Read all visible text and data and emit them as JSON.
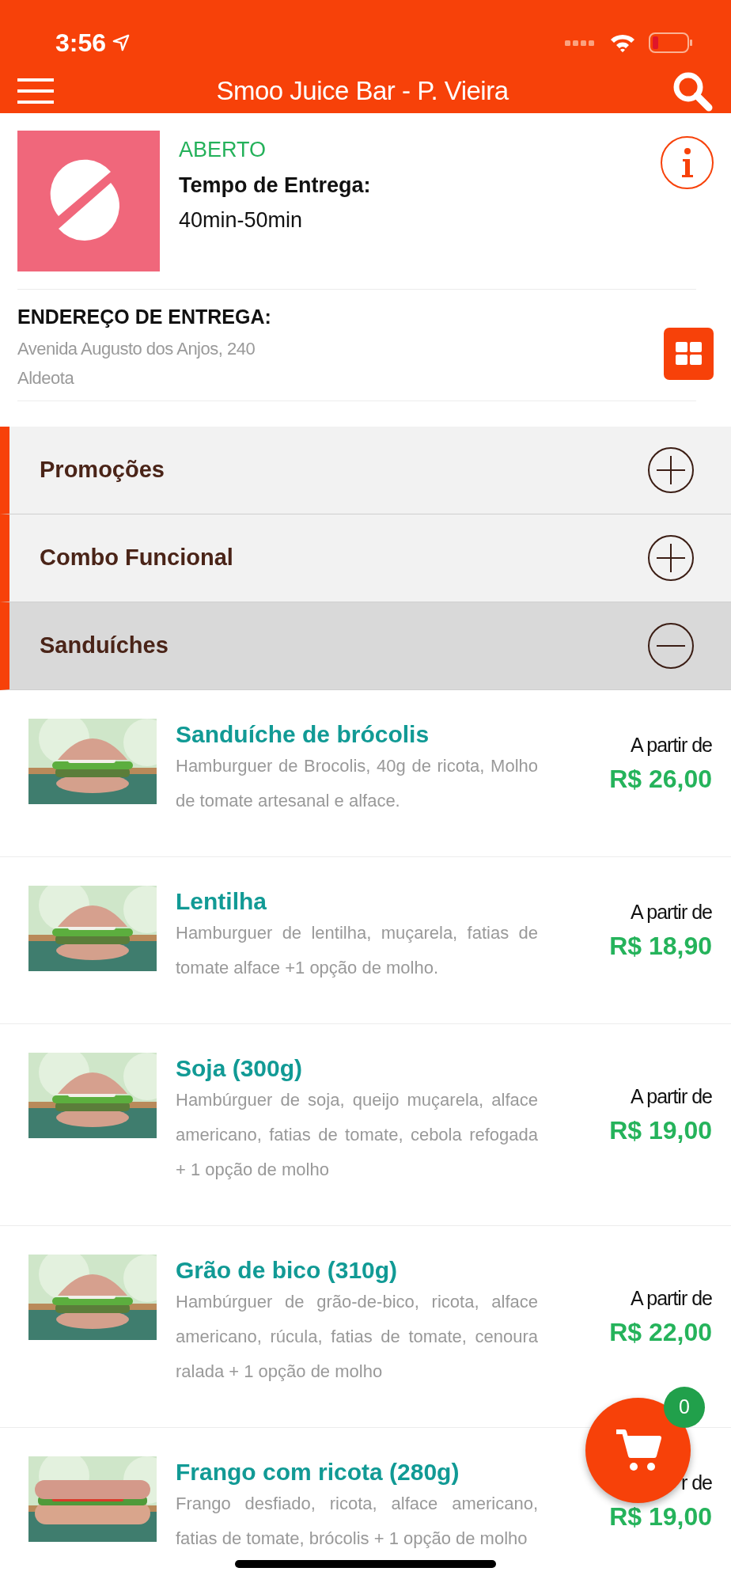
{
  "status_bar": {
    "time": "3:56"
  },
  "header": {
    "title": "Smoo Juice Bar - P. Vieira"
  },
  "store": {
    "status": "ABERTO",
    "delivery_label": "Tempo de Entrega:",
    "delivery_time": "40min-50min",
    "address_label": "ENDEREÇO DE ENTREGA:",
    "address_lines": [
      "Avenida Augusto dos Anjos, 240",
      "Aldeota"
    ]
  },
  "categories": [
    {
      "label": "Promoções",
      "expanded": false
    },
    {
      "label": "Combo Funcional",
      "expanded": false
    },
    {
      "label": "Sanduíches",
      "expanded": true
    }
  ],
  "products": [
    {
      "name": "Sanduíche de brócolis",
      "description": "Hamburguer de Brocolis, 40g de ricota, Molho de tomate artesanal e alface.",
      "from_label": "A partir de",
      "price": "R$ 26,00"
    },
    {
      "name": "Lentilha",
      "description": "Hamburguer de lentilha, muçarela, fatias de tomate alface +1 opção de molho.",
      "from_label": "A partir de",
      "price": "R$ 18,90"
    },
    {
      "name": "Soja (300g)",
      "description": "Hambúrguer de soja, queijo muçarela, alface americano, fatias de tomate, cebola refogada + 1 opção de molho",
      "from_label": "A partir de",
      "price": "R$ 19,00"
    },
    {
      "name": "Grão de bico (310g)",
      "description": "Hambúrguer de grão-de-bico, ricota, alface americano, rúcula, fatias de tomate, cenoura ralada + 1 opção de molho",
      "from_label": "A partir de",
      "price": "R$ 22,00"
    },
    {
      "name": "Frango com ricota (280g)",
      "description": "Frango desfiado, ricota, alface americano, fatias de tomate, brócolis + 1 opção de molho",
      "from_label": "r de",
      "price": "R$ 19,00"
    }
  ],
  "cart": {
    "count": "0"
  }
}
